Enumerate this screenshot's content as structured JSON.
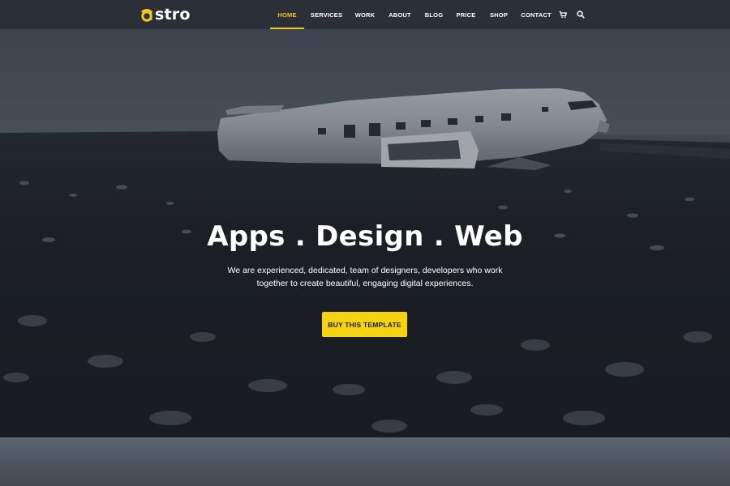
{
  "brand": {
    "logo_text": "stro",
    "logo_mark": "a",
    "accent": "#f2c81e"
  },
  "nav": {
    "items": [
      {
        "label": "HOME",
        "active": true
      },
      {
        "label": "SERVICES",
        "active": false
      },
      {
        "label": "WORK",
        "active": false
      },
      {
        "label": "ABOUT",
        "active": false
      },
      {
        "label": "BLOG",
        "active": false
      },
      {
        "label": "PRICE",
        "active": false
      },
      {
        "label": "SHOP",
        "active": false
      },
      {
        "label": "CONTACT",
        "active": false
      }
    ],
    "icons": [
      "cart-icon",
      "search-icon"
    ]
  },
  "hero": {
    "title": "Apps . Design . Web",
    "subtitle": "We are experienced, dedicated, team of designers, developers who work together to create beautiful, engaging digital experiences.",
    "cta_label": "BUY THIS TEMPLATE",
    "cta_color": "#f5d40f"
  }
}
